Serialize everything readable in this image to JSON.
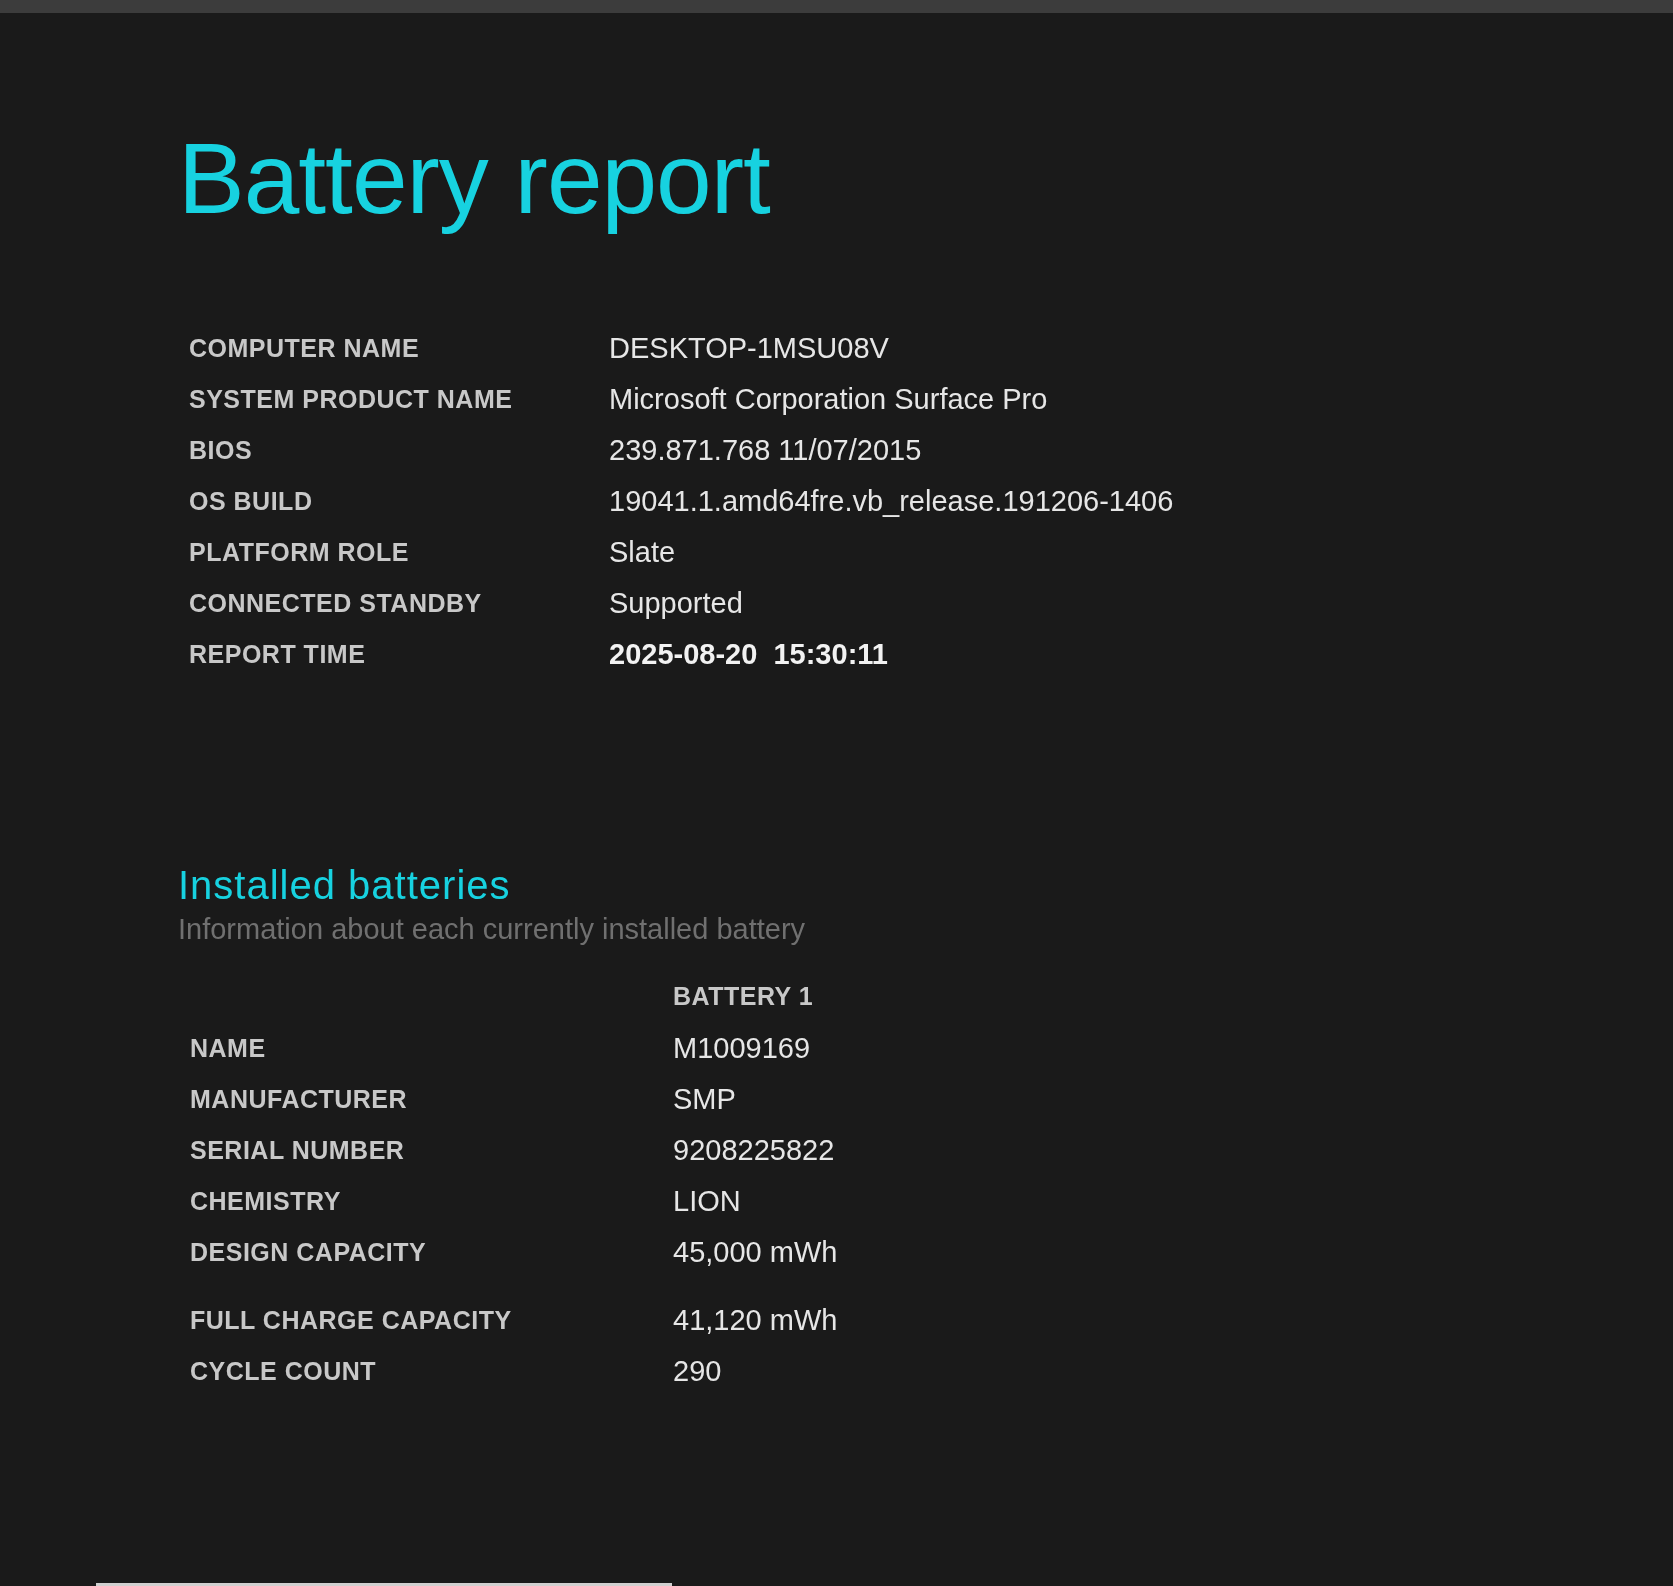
{
  "title": "Battery report",
  "system_info": [
    {
      "label": "COMPUTER NAME",
      "value": "DESKTOP-1MSU08V",
      "bold": false
    },
    {
      "label": "SYSTEM PRODUCT NAME",
      "value": "Microsoft Corporation Surface Pro",
      "bold": false
    },
    {
      "label": "BIOS",
      "value": "239.871.768 11/07/2015",
      "bold": false
    },
    {
      "label": "OS BUILD",
      "value": "19041.1.amd64fre.vb_release.191206-1406",
      "bold": false
    },
    {
      "label": "PLATFORM ROLE",
      "value": "Slate",
      "bold": false
    },
    {
      "label": "CONNECTED STANDBY",
      "value": "Supported",
      "bold": false
    },
    {
      "label": "REPORT TIME",
      "value": "2025-08-20  15:30:11",
      "bold": true
    }
  ],
  "installed_batteries": {
    "heading": "Installed batteries",
    "subtitle": "Information about each currently installed battery",
    "column_header": "BATTERY 1",
    "row_groups": [
      [
        {
          "label": "NAME",
          "value": "M1009169"
        },
        {
          "label": "MANUFACTURER",
          "value": "SMP"
        },
        {
          "label": "SERIAL NUMBER",
          "value": "9208225822"
        },
        {
          "label": "CHEMISTRY",
          "value": "LION"
        },
        {
          "label": "DESIGN CAPACITY",
          "value": "45,000 mWh"
        }
      ],
      [
        {
          "label": "FULL CHARGE CAPACITY",
          "value": "41,120 mWh"
        },
        {
          "label": "CYCLE COUNT",
          "value": "290"
        }
      ]
    ]
  }
}
